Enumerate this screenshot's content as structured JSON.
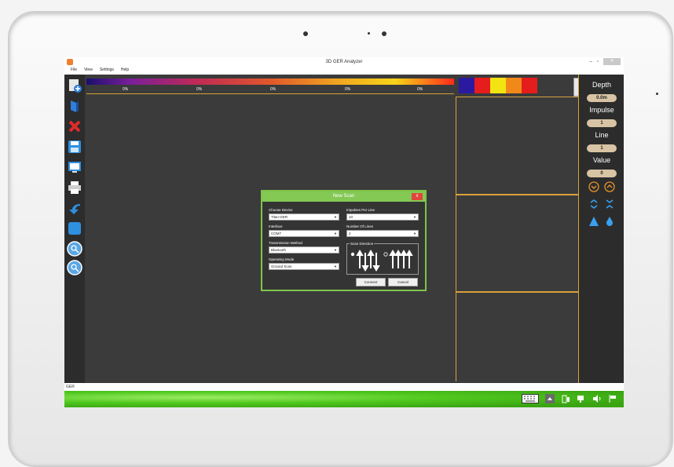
{
  "window": {
    "title": "3D GER Analyzer",
    "minimize": "–",
    "maximize": "▫",
    "close": "✕"
  },
  "menu": [
    "File",
    "View",
    "Settings",
    "Help"
  ],
  "colorbar": {
    "percent_labels": [
      "0%",
      "0%",
      "0%",
      "0%",
      "0%"
    ],
    "swatches": [
      "#2b1aa0",
      "#e51d1d",
      "#f2e312",
      "#f0891a",
      "#e51d1d"
    ]
  },
  "toolbar_icons": [
    "new-scan-icon",
    "open-book-icon",
    "delete-icon",
    "save-icon",
    "display-icon",
    "print-icon",
    "undo-icon",
    "blank-icon",
    "zoom-icon",
    "zoom-alt-icon"
  ],
  "readouts": {
    "depth": {
      "label": "Depth",
      "value": "0.0m"
    },
    "impulse": {
      "label": "Impulse",
      "value": "1"
    },
    "line": {
      "label": "Line",
      "value": "1"
    },
    "value": {
      "label": "Value",
      "value": "0"
    }
  },
  "dialog": {
    "title": "New Scan",
    "close": "x",
    "choose_device_label": "Choose Device",
    "choose_device_value": "Titan-GER",
    "interface_label": "Interface",
    "interface_value": "COM7",
    "transmission_label": "Transmission Method",
    "transmission_value": "Bluetooth",
    "mode_label": "Operating Mode",
    "mode_value": "Ground Scan",
    "impulses_label": "Impulses Per Line",
    "impulses_value": "10",
    "lines_label": "Number Of Lines",
    "lines_value": "2",
    "scan_direction_label": "Scan Direction",
    "connect": "Connect",
    "cancel": "Cancel"
  },
  "status": {
    "text": "GER"
  },
  "colors": {
    "accent_orange": "#d9a13a",
    "dialog_green": "#83c954",
    "taskbar_green": "#4fc81e"
  }
}
